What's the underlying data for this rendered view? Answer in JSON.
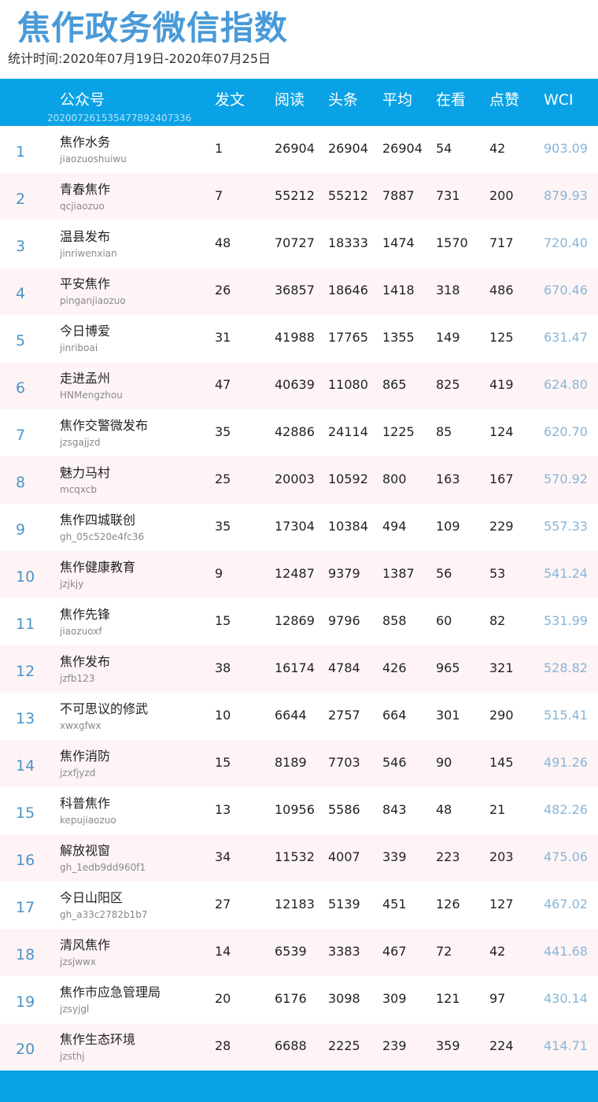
{
  "title": "焦作政务微信指数",
  "period": "统计时间:2020年07月19日-2020年07月25日",
  "columns": {
    "account": "公众号",
    "posts": "发文",
    "reads": "阅读",
    "headline": "头条",
    "average": "平均",
    "watching": "在看",
    "likes": "点赞",
    "wci": "WCI"
  },
  "watermark": "20200726153547789​2407336",
  "rows": [
    {
      "rank": "1",
      "name": "焦作水务",
      "id": "jiaozuoshuiwu",
      "posts": "1",
      "reads": "26904",
      "headline": "26904",
      "average": "26904",
      "watching": "54",
      "likes": "42",
      "wci": "903.09"
    },
    {
      "rank": "2",
      "name": "青春焦作",
      "id": "qcjiaozuo",
      "posts": "7",
      "reads": "55212",
      "headline": "55212",
      "average": "7887",
      "watching": "731",
      "likes": "200",
      "wci": "879.93"
    },
    {
      "rank": "3",
      "name": "温县发布",
      "id": "jinriwenxian",
      "posts": "48",
      "reads": "70727",
      "headline": "18333",
      "average": "1474",
      "watching": "1570",
      "likes": "717",
      "wci": "720.40"
    },
    {
      "rank": "4",
      "name": "平安焦作",
      "id": "pinganjiaozuo",
      "posts": "26",
      "reads": "36857",
      "headline": "18646",
      "average": "1418",
      "watching": "318",
      "likes": "486",
      "wci": "670.46"
    },
    {
      "rank": "5",
      "name": "今日博爱",
      "id": "jinriboai",
      "posts": "31",
      "reads": "41988",
      "headline": "17765",
      "average": "1355",
      "watching": "149",
      "likes": "125",
      "wci": "631.47"
    },
    {
      "rank": "6",
      "name": "走进孟州",
      "id": "HNMengzhou",
      "posts": "47",
      "reads": "40639",
      "headline": "11080",
      "average": "865",
      "watching": "825",
      "likes": "419",
      "wci": "624.80"
    },
    {
      "rank": "7",
      "name": "焦作交警微发布",
      "id": "jzsgajjzd",
      "posts": "35",
      "reads": "42886",
      "headline": "24114",
      "average": "1225",
      "watching": "85",
      "likes": "124",
      "wci": "620.70"
    },
    {
      "rank": "8",
      "name": "魅力马村",
      "id": "mcqxcb",
      "posts": "25",
      "reads": "20003",
      "headline": "10592",
      "average": "800",
      "watching": "163",
      "likes": "167",
      "wci": "570.92"
    },
    {
      "rank": "9",
      "name": "焦作四城联创",
      "id": "gh_05c520e4fc36",
      "posts": "35",
      "reads": "17304",
      "headline": "10384",
      "average": "494",
      "watching": "109",
      "likes": "229",
      "wci": "557.33"
    },
    {
      "rank": "10",
      "name": "焦作健康教育",
      "id": "jzjkjy",
      "posts": "9",
      "reads": "12487",
      "headline": "9379",
      "average": "1387",
      "watching": "56",
      "likes": "53",
      "wci": "541.24"
    },
    {
      "rank": "11",
      "name": "焦作先锋",
      "id": "jiaozuoxf",
      "posts": "15",
      "reads": "12869",
      "headline": "9796",
      "average": "858",
      "watching": "60",
      "likes": "82",
      "wci": "531.99"
    },
    {
      "rank": "12",
      "name": "焦作发布",
      "id": "jzfb123",
      "posts": "38",
      "reads": "16174",
      "headline": "4784",
      "average": "426",
      "watching": "965",
      "likes": "321",
      "wci": "528.82"
    },
    {
      "rank": "13",
      "name": "不可思议的修武",
      "id": "xwxgfwx",
      "posts": "10",
      "reads": "6644",
      "headline": "2757",
      "average": "664",
      "watching": "301",
      "likes": "290",
      "wci": "515.41"
    },
    {
      "rank": "14",
      "name": "焦作消防",
      "id": "jzxfjyzd",
      "posts": "15",
      "reads": "8189",
      "headline": "7703",
      "average": "546",
      "watching": "90",
      "likes": "145",
      "wci": "491.26"
    },
    {
      "rank": "15",
      "name": "科普焦作",
      "id": "kepujiaozuo",
      "posts": "13",
      "reads": "10956",
      "headline": "5586",
      "average": "843",
      "watching": "48",
      "likes": "21",
      "wci": "482.26"
    },
    {
      "rank": "16",
      "name": "解放视窗",
      "id": "gh_1edb9dd960f1",
      "posts": "34",
      "reads": "11532",
      "headline": "4007",
      "average": "339",
      "watching": "223",
      "likes": "203",
      "wci": "475.06"
    },
    {
      "rank": "17",
      "name": "今日山阳区",
      "id": "gh_a33c2782b1b7",
      "posts": "27",
      "reads": "12183",
      "headline": "5139",
      "average": "451",
      "watching": "126",
      "likes": "127",
      "wci": "467.02"
    },
    {
      "rank": "18",
      "name": "清风焦作",
      "id": "jzsjwwx",
      "posts": "14",
      "reads": "6539",
      "headline": "3383",
      "average": "467",
      "watching": "72",
      "likes": "42",
      "wci": "441.68"
    },
    {
      "rank": "19",
      "name": "焦作市应急管理局",
      "id": "jzsyjgl",
      "posts": "20",
      "reads": "6176",
      "headline": "3098",
      "average": "309",
      "watching": "121",
      "likes": "97",
      "wci": "430.14"
    },
    {
      "rank": "20",
      "name": "焦作生态环境",
      "id": "jzsthj",
      "posts": "28",
      "reads": "6688",
      "headline": "2225",
      "average": "239",
      "watching": "359",
      "likes": "224",
      "wci": "414.71"
    }
  ]
}
